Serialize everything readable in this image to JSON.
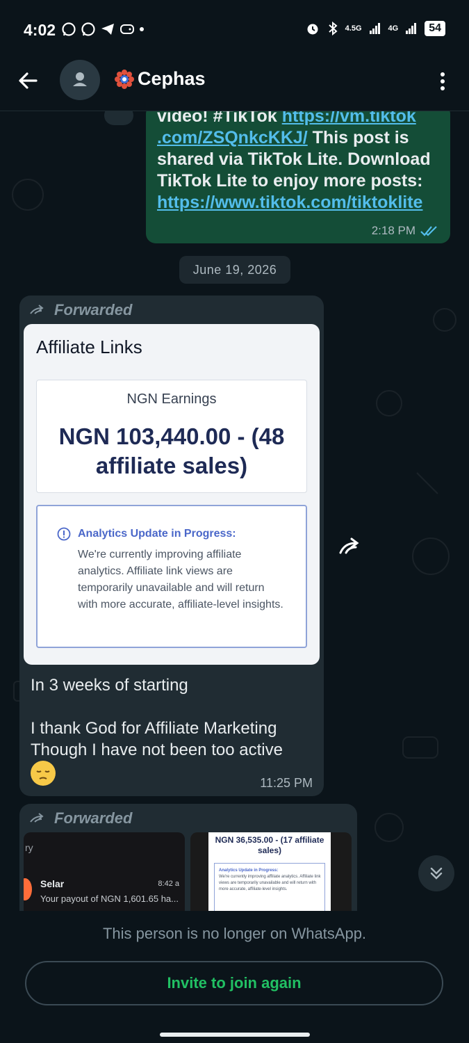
{
  "status_bar": {
    "time": "4:02",
    "network_1": "4.5G",
    "network_2": "4G",
    "battery": "54"
  },
  "header": {
    "contact_name": "Cephas",
    "icons": [
      "back-arrow-icon",
      "avatar-icon",
      "more-vert-icon"
    ]
  },
  "messages": {
    "outgoing_1": {
      "text_line1": "video! #TikTok ",
      "link1a": "https://vm.tiktok",
      "link1b": ".com/ZSQnkcKKJ/",
      "text_mid": " This post is shared via TikTok Lite. Download TikTok Lite to enjoy more posts: ",
      "link2": "https://www.tiktok.com/tiktoklite",
      "time": "2:18 PM"
    },
    "date_divider": "June 19, 2026",
    "incoming_1": {
      "forwarded_label": "Forwarded",
      "image": {
        "title": "Affiliate Links",
        "earnings_label": "NGN Earnings",
        "earnings_amount": "NGN 103,440.00 - (48 affiliate sales)",
        "notice_title": "Analytics Update in Progress:",
        "notice_body": "We're currently improving affiliate analytics. Affiliate link views are temporarily unavailable and will return with more accurate, affiliate-level insights."
      },
      "text": "In 3 weeks of starting\n\nI thank God for Affiliate Marketing Though I have not been too active",
      "time": "11:25 PM"
    },
    "incoming_2": {
      "forwarded_label": "Forwarded",
      "thumb1": {
        "snippet": "ry",
        "name": "Selar",
        "time": "8:42 a",
        "message": "Your payout of NGN 1,601.65 ha..."
      },
      "thumb2": {
        "amount": "NGN 36,535.00 - (17 affiliate sales)",
        "notice_title": "Analytics Update in Progress:",
        "notice_body": "We're currently improving affiliate analytics. Affiliate link views are temporarily unavailable and will return with more accurate, affiliate-level insights."
      }
    }
  },
  "footer": {
    "notice": "This person is no longer on WhatsApp.",
    "invite_label": "Invite to join again"
  },
  "colors": {
    "background": "#0b141a",
    "outgoing_bubble": "#144d37",
    "incoming_bubble": "#202c33",
    "accent_green": "#21c063",
    "link_blue": "#53bdeb"
  }
}
